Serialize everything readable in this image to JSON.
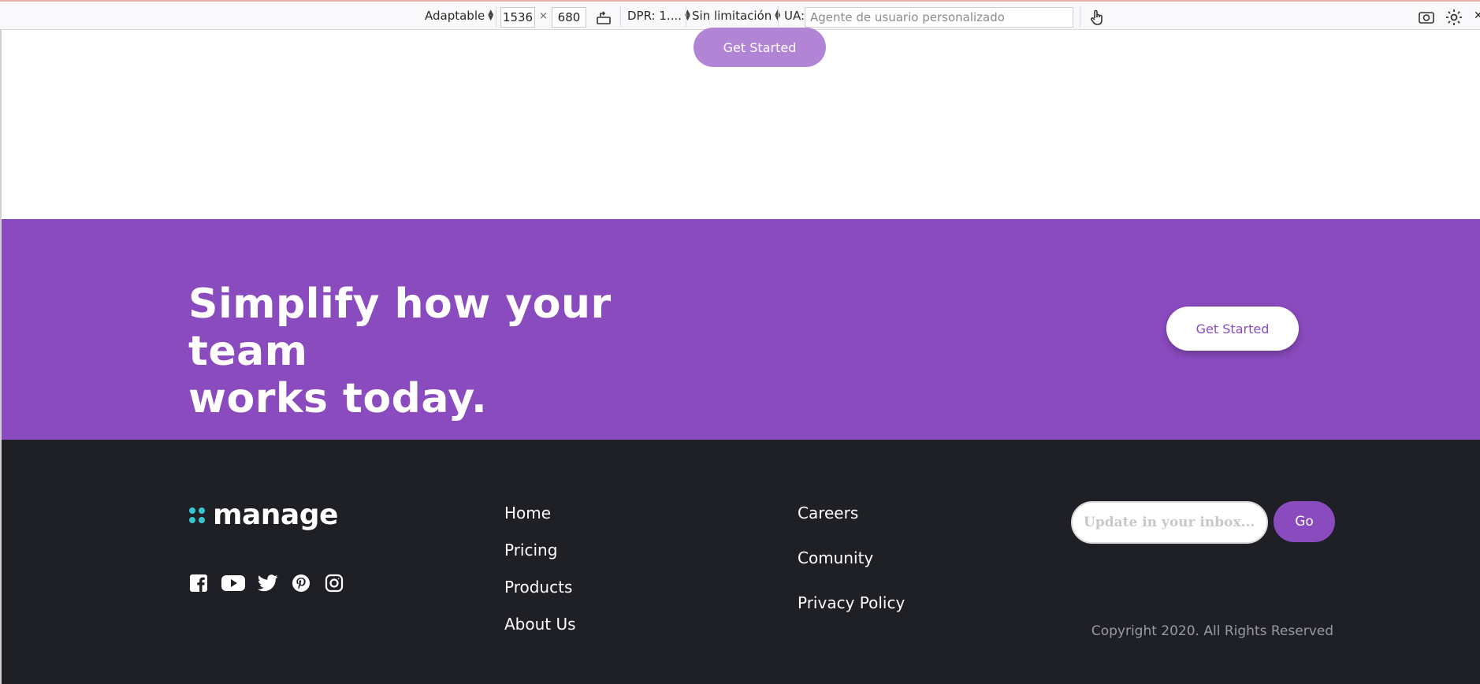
{
  "toolbar": {
    "device_mode": "Adaptable",
    "width": "1536",
    "times": "×",
    "height": "680",
    "dpr": "DPR: 1....",
    "throttling": "Sin limitación",
    "ua_label": "UA:",
    "ua_placeholder": "Agente de usuario personalizado",
    "icons": [
      "rotate-icon",
      "touch-icon",
      "screenshot-icon",
      "settings-icon"
    ]
  },
  "hero": {
    "cta_label": "Get Started"
  },
  "cta_band": {
    "title_line1": "Simplify how your team",
    "title_line2": "works today.",
    "button_label": "Get Started",
    "background": "#8a4bbf"
  },
  "footer": {
    "logo_text": "manage",
    "nav_primary": [
      "Home",
      "Pricing",
      "Products",
      "About Us"
    ],
    "nav_secondary": [
      "Careers",
      "Comunity",
      "Privacy Policy"
    ],
    "newsletter_placeholder": "Update in your inbox...",
    "go_label": "Go",
    "copyright": "Copyright 2020. All Rights Reserved",
    "socials": [
      "facebook-icon",
      "youtube-icon",
      "twitter-icon",
      "pinterest-icon",
      "instagram-icon"
    ],
    "background": "#1f1f26",
    "accent": "#38c5d0"
  }
}
